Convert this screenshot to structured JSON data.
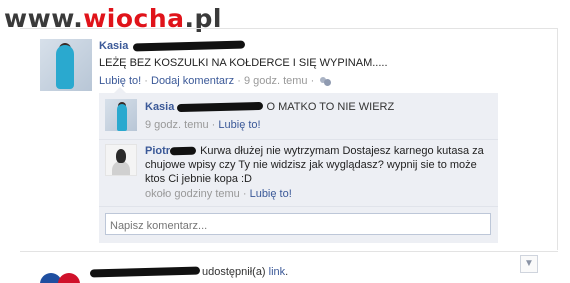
{
  "watermark": {
    "part1": "www.",
    "part2": "wiocha",
    "part3": ".pl"
  },
  "post": {
    "author": "Kasia",
    "text": "LEŻĘ BEZ KOSZULKI NA KOŁDERCE I SIĘ WYPINAM.....",
    "like_label": "Lubię to!",
    "comment_label": "Dodaj komentarz",
    "time": "9 godz. temu",
    "separator": "·"
  },
  "comments": [
    {
      "author": "Kasia",
      "text": "O MATKO TO NIE WIERZ",
      "time": "9 godz. temu",
      "like_label": "Lubię to!"
    },
    {
      "author": "Piotr",
      "text": "Kurwa dłużej nie wytrzymam Dostajesz karnego kutasa za chujowe wpisy czy Ty nie widzisz jak wyglądasz? wypnij sie to może ktos Ci jebnie kopa :D",
      "time": "około godziny temu",
      "like_label": "Lubię to!"
    }
  ],
  "comment_input": {
    "placeholder": "Napisz komentarz..."
  },
  "next_story": {
    "text": "udostępnił(a)",
    "link": "link",
    "end": "."
  },
  "icons": {
    "audience": "people-icon",
    "expand": "chevron-down-icon"
  }
}
